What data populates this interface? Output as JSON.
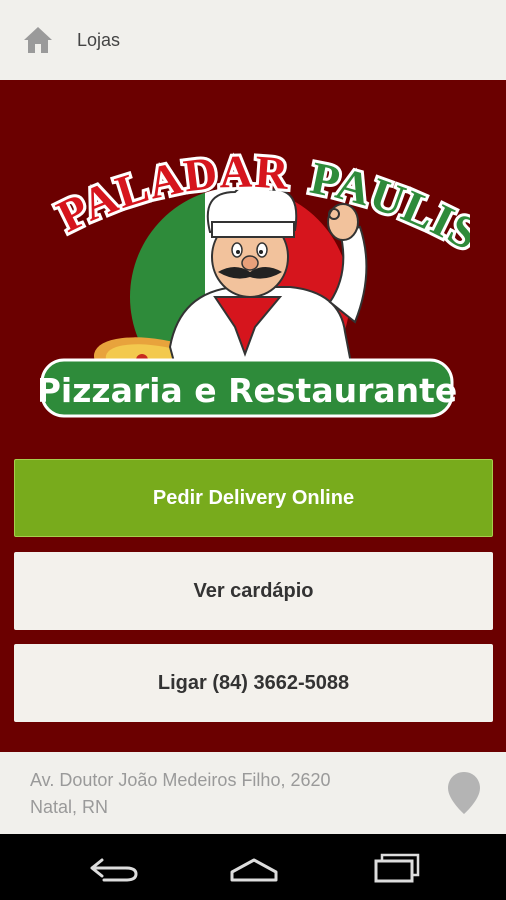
{
  "topbar": {
    "title": "Lojas",
    "home_icon": "home-icon"
  },
  "logo": {
    "name_part1": "PALADAR",
    "name_part2": "PAULISTANO",
    "tagline": "Pizzaria e Restaurante"
  },
  "buttons": {
    "delivery": "Pedir Delivery Online",
    "menu": "Ver cardápio",
    "call": "Ligar (84) 3662-5088"
  },
  "address": {
    "line1": "Av. Doutor João Medeiros Filho, 2620",
    "line2": "Natal, RN",
    "pin_icon": "map-pin-icon"
  },
  "navbar": {
    "back_icon": "back-icon",
    "home_icon": "nav-home-icon",
    "recent_icon": "recent-apps-icon"
  },
  "colors": {
    "background": "#6b0000",
    "primary_button": "#78ab1c",
    "secondary_button": "#f3f1ec",
    "logo_red": "#d6151d",
    "logo_green": "#2e8b3a"
  }
}
